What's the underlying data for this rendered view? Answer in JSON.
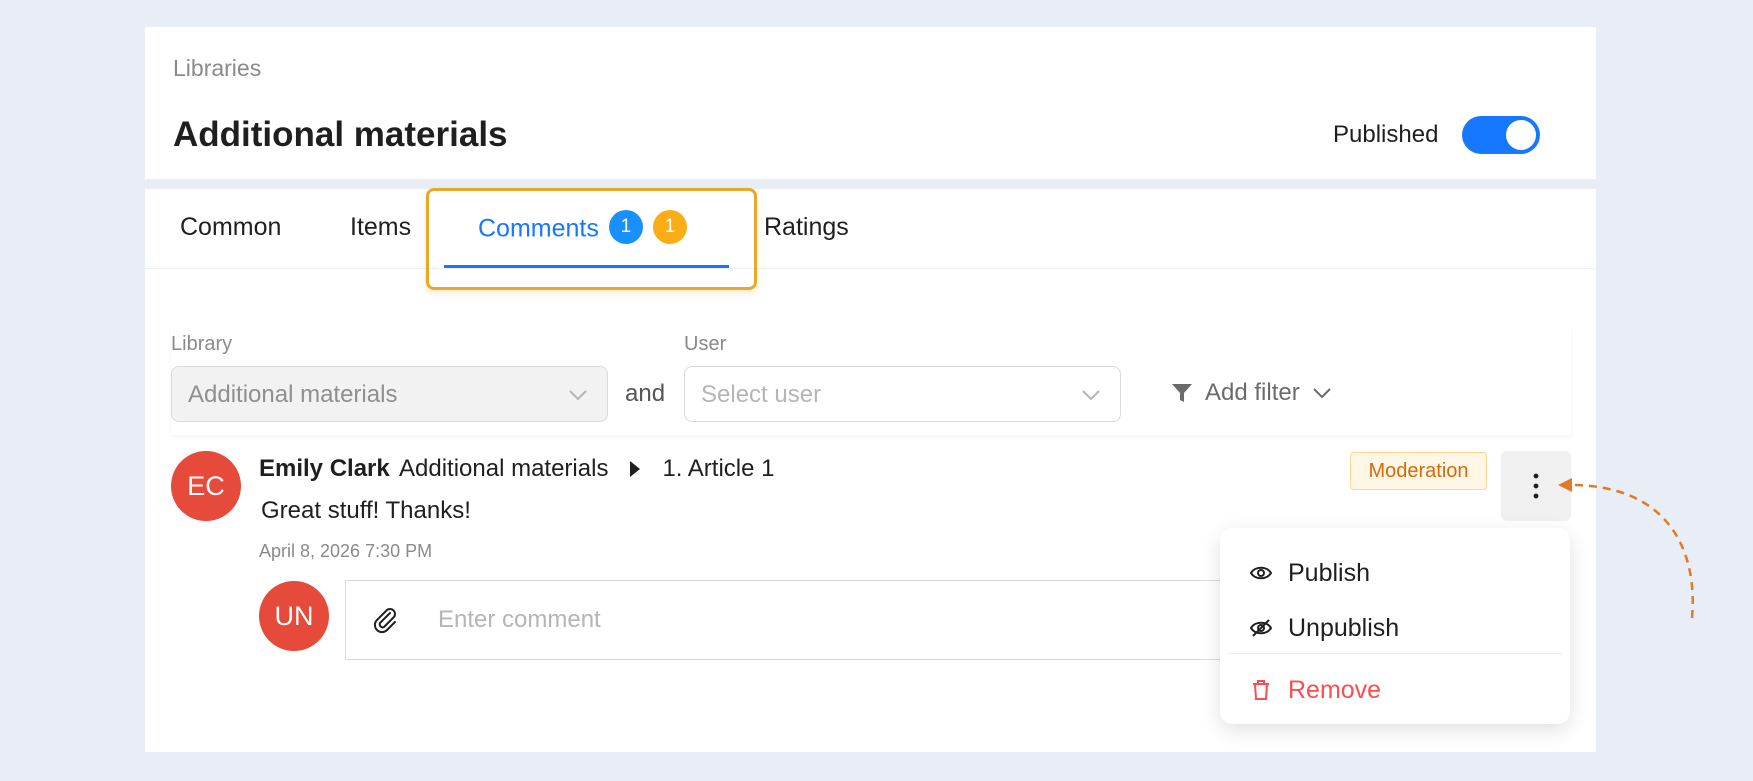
{
  "breadcrumb": "Libraries",
  "title": "Additional materials",
  "published_label": "Published",
  "published_on": true,
  "tabs": [
    {
      "label": "Common"
    },
    {
      "label": "Items"
    },
    {
      "label": "Comments",
      "badge_blue": "1",
      "badge_orange": "1"
    },
    {
      "label": "Ratings"
    }
  ],
  "filters": {
    "library_label": "Library",
    "library_value": "Additional materials",
    "and_text": "and",
    "user_label": "User",
    "user_placeholder": "Select user",
    "add_filter": "Add filter"
  },
  "comment": {
    "avatar": "EC",
    "author": "Emily Clark",
    "path_library": "Additional materials",
    "path_item": "1. Article 1",
    "text": "Great stuff! Thanks!",
    "timestamp": "April 8, 2026 7:30 PM",
    "status": "Moderation"
  },
  "reply": {
    "avatar": "UN",
    "placeholder": "Enter comment"
  },
  "menu": {
    "publish": "Publish",
    "unpublish": "Unpublish",
    "remove": "Remove"
  },
  "colors": {
    "accent": "#1677ff",
    "badge_orange": "#faad14",
    "avatar": "#e64a3b",
    "danger": "#ff4d4f",
    "highlight": "#e8a92a"
  }
}
